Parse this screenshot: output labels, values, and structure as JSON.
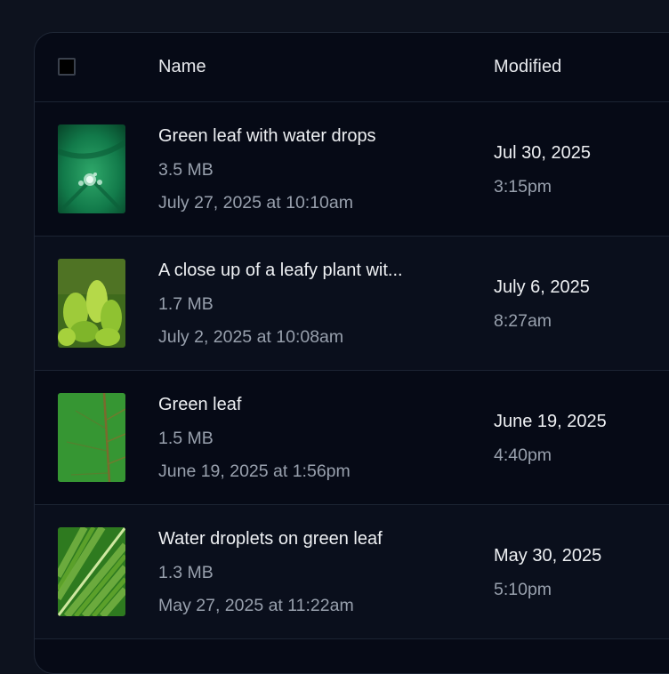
{
  "header": {
    "name_label": "Name",
    "modified_label": "Modified"
  },
  "files": [
    {
      "name": "Green leaf with water drops",
      "size": "3.5 MB",
      "created": "July 27, 2025 at 10:10am",
      "modified_date": "Jul 30, 2025",
      "modified_time": "3:15pm"
    },
    {
      "name": "A close up of a leafy plant wit...",
      "size": "1.7 MB",
      "created": "July 2, 2025 at 10:08am",
      "modified_date": "July 6, 2025",
      "modified_time": "8:27am"
    },
    {
      "name": "Green leaf",
      "size": "1.5 MB",
      "created": "June 19, 2025 at 1:56pm",
      "modified_date": "June 19, 2025",
      "modified_time": "4:40pm"
    },
    {
      "name": "Water droplets on green leaf",
      "size": "1.3 MB",
      "created": "May 27, 2025 at 11:22am",
      "modified_date": "May 30, 2025",
      "modified_time": "5:10pm"
    }
  ]
}
